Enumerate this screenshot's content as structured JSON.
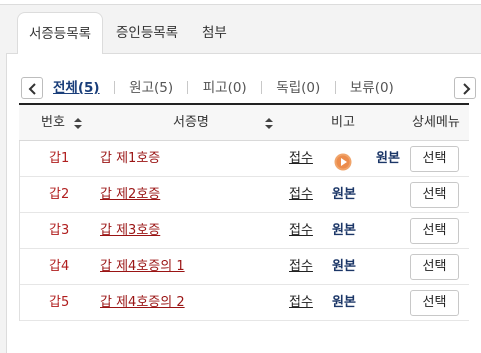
{
  "tabs": [
    {
      "label": "서증등목록"
    },
    {
      "label": "증인등목록"
    },
    {
      "label": "첨부"
    }
  ],
  "filters": [
    {
      "label": "전체(5)"
    },
    {
      "label": "원고(5)"
    },
    {
      "label": "피고(0)"
    },
    {
      "label": "독립(0)"
    },
    {
      "label": "보류(0)"
    }
  ],
  "table": {
    "headers": {
      "num": "번호",
      "name": "서증명",
      "note": "비고",
      "menu": "상세메뉴"
    },
    "rows": [
      {
        "num": "갑1",
        "name": "갑 제1호증",
        "receive": "접수",
        "original": "원본",
        "select": "선택"
      },
      {
        "num": "갑2",
        "name": "갑 제2호증",
        "receive": "접수",
        "original": "원본",
        "select": "선택"
      },
      {
        "num": "갑3",
        "name": "갑 제3호증",
        "receive": "접수",
        "original": "원본",
        "select": "선택"
      },
      {
        "num": "갑4",
        "name": "갑 제4호증의 1",
        "receive": "접수",
        "original": "원본",
        "select": "선택"
      },
      {
        "num": "갑5",
        "name": "갑 제4호증의 2",
        "receive": "접수",
        "original": "원본",
        "select": "선택"
      }
    ]
  },
  "colors": {
    "accent": "#1a3e7a",
    "code_red": "#b01e1e",
    "play_orange": "#f0a46a"
  }
}
